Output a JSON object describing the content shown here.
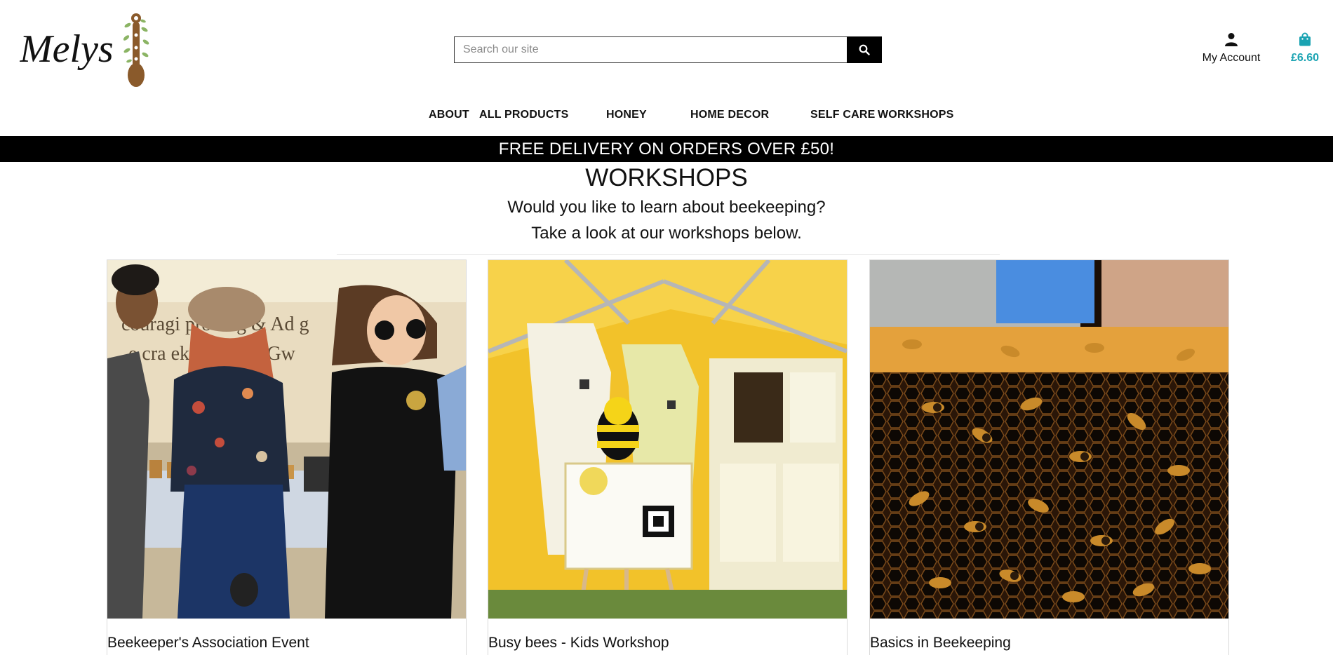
{
  "header": {
    "logo_text": "Melys",
    "search_placeholder": "Search our site",
    "account_label": "My Account",
    "cart_total": "£6.60"
  },
  "nav": {
    "items": [
      {
        "label": "ABOUT"
      },
      {
        "label": "ALL PRODUCTS"
      },
      {
        "label": "HONEY"
      },
      {
        "label": "HOME DECOR"
      },
      {
        "label": "SELF CARE"
      },
      {
        "label": "WORKSHOPS"
      }
    ]
  },
  "banner": {
    "text": "FREE DELIVERY ON ORDERS OVER £50!"
  },
  "main": {
    "title": "WORKSHOPS",
    "subtitle_line1": "Would you like to learn about beekeeping?",
    "subtitle_line2": "Take a look at our workshops below."
  },
  "cards": [
    {
      "title": "Beekeeper's Association Event",
      "image_text_line1": "couragi  proving & Ad  g",
      "image_text_line2": "e cra   ekeeping in Gw"
    },
    {
      "title": "Busy bees - Kids Workshop"
    },
    {
      "title": "Basics in Beekeeping"
    }
  ],
  "icons": {
    "search": "search-icon",
    "account": "user-icon",
    "cart": "shopping-bag-icon",
    "logo": "love-spoon-icon"
  },
  "colors": {
    "accent": "#1aa3b2",
    "banner_bg": "#000000",
    "banner_text": "#ffffff",
    "tent_yellow": "#f2c22a"
  }
}
